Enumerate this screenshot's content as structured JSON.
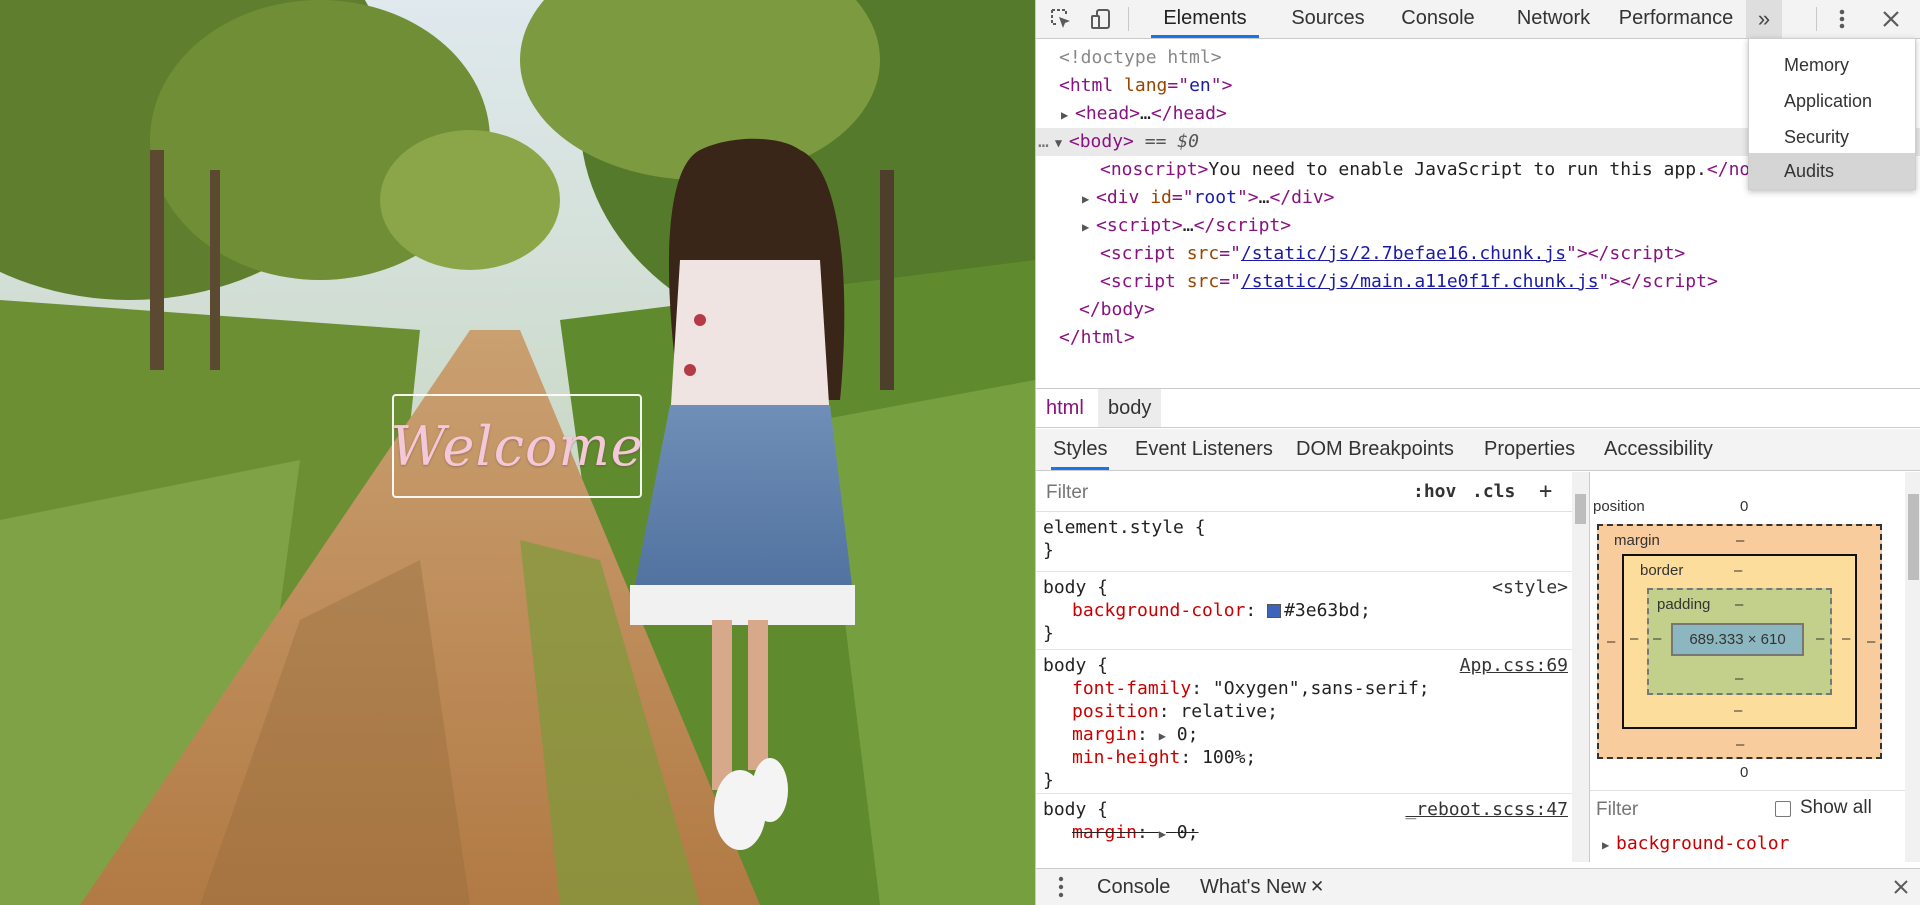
{
  "page": {
    "welcome_text": "Welcome"
  },
  "devtools": {
    "tabs": [
      "Elements",
      "Sources",
      "Console",
      "Network",
      "Performance"
    ],
    "active_tab": "Elements",
    "overflow_glyph": "»",
    "overflow_menu": [
      "Memory",
      "Application",
      "Security",
      "Audits"
    ],
    "overflow_hover": "Audits",
    "icons": {
      "inspect": "inspect-element-icon",
      "device": "device-toolbar-icon",
      "more": "more-vert-icon",
      "close": "close-icon"
    },
    "tree": {
      "doctype": "<!doctype html>",
      "html_open_tag": "html",
      "html_lang_attr": "lang",
      "html_lang_val": "en",
      "head_tag": "head",
      "ellipsis": "…",
      "body_tag": "body",
      "body_selected_marker": "== $0",
      "noscript_tag": "noscript",
      "noscript_text": "You need to enable JavaScript to run this app.",
      "noscript_close_partial": "</no",
      "div_tag": "div",
      "div_id_attr": "id",
      "div_id_val": "root",
      "script_tag": "script",
      "script_src_attr": "src",
      "script1_src": "/static/js/2.7befae16.chunk.js",
      "script2_src": "/static/js/main.a11e0f1f.chunk.js",
      "body_close": "</body>",
      "html_close": "</html>"
    },
    "breadcrumbs": [
      "html",
      "body"
    ],
    "subtabs": [
      "Styles",
      "Event Listeners",
      "DOM Breakpoints",
      "Properties",
      "Accessibility"
    ],
    "active_subtab": "Styles",
    "styles": {
      "filter_placeholder": "Filter",
      "hov": ":hov",
      "cls": ".cls",
      "add": "+",
      "element_style_selector": "element.style {",
      "close_brace": "}",
      "rules": [
        {
          "selector": "body {",
          "source": "<style>",
          "props": [
            {
              "name": "background-color",
              "value": "#3e63bd",
              "swatch": true
            }
          ]
        },
        {
          "selector": "body {",
          "source": "App.css:69",
          "props": [
            {
              "name": "font-family",
              "value": "\"Oxygen\",sans-serif;"
            },
            {
              "name": "position",
              "value": "relative;"
            },
            {
              "name": "margin",
              "value": "0;"
            },
            {
              "name": "min-height",
              "value": "100%;"
            }
          ]
        },
        {
          "selector": "body {",
          "source": "_reboot.scss:47",
          "props": [
            {
              "name": "margin",
              "value": "0;"
            }
          ]
        }
      ]
    },
    "box_model": {
      "position_label": "position",
      "position_top": "0",
      "position_bottom": "0",
      "margin_label": "margin",
      "border_label": "border",
      "padding_label": "padding",
      "dash": "–",
      "content_size": "689.333 × 610",
      "filter_placeholder": "Filter",
      "show_all_label": "Show all",
      "computed_first": "background-color"
    },
    "drawer": {
      "console_label": "Console",
      "whats_new_label": "What's New"
    },
    "colors": {
      "accent": "#1a73e8",
      "swatch": "#3e63bd"
    }
  }
}
